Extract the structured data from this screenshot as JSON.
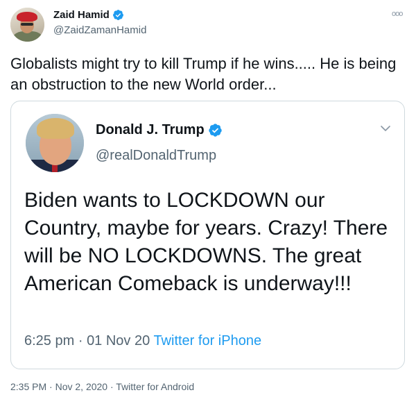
{
  "tweet": {
    "author": {
      "name": "Zaid Hamid",
      "handle": "@ZaidZamanHamid",
      "verified": true,
      "avatar": "profile-photo"
    },
    "more_icon": "more-options-icon",
    "text": "Globalists might try to kill Trump if he wins..... He is being an obstruction to the new World order...",
    "quoted": {
      "author": {
        "name": "Donald J. Trump",
        "handle": "@realDonaldTrump",
        "verified": true,
        "avatar": "profile-photo"
      },
      "menu_icon": "chevron-down-icon",
      "text": "Biden wants to LOCKDOWN our Country, maybe for years. Crazy! There will be NO LOCKDOWNS. The great American Comeback is underway!!!",
      "time": "6:25 pm",
      "separator": "·",
      "date": "01 Nov 20",
      "source": "Twitter for iPhone"
    },
    "footer": {
      "time": "2:35 PM",
      "separator": "·",
      "date": "Nov 2, 2020",
      "source": "Twitter for Android"
    }
  },
  "colors": {
    "link": "#1d9bf0",
    "secondary_text": "#536471",
    "border": "#cfd9de",
    "verified_badge": "#1d9bf0"
  }
}
